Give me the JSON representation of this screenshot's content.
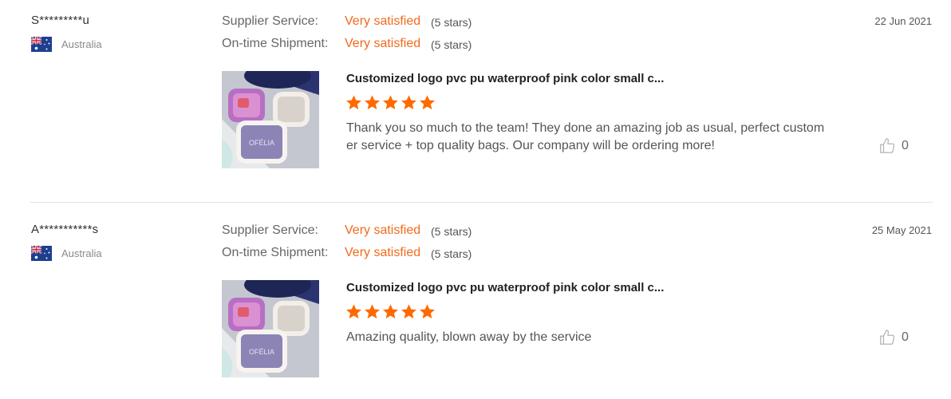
{
  "reviews": [
    {
      "user": "S*********u",
      "country": "Australia",
      "supplier_label": "Supplier Service:",
      "supplier_value": "Very satisfied",
      "supplier_stars": "(5 stars)",
      "shipment_label": "On-time Shipment:",
      "shipment_value": "Very satisfied",
      "shipment_stars": "(5 stars)",
      "date": "22 Jun 2021",
      "product_title": "Customized logo pvc pu waterproof pink color small c...",
      "rating": 5,
      "comment": "Thank you so much to the team! They done an amazing job as usual, perfect customer service + top quality bags. Our company will be ordering more!",
      "likes": "0",
      "flag_icon": "australia-flag-icon"
    },
    {
      "user": "A***********s",
      "country": "Australia",
      "supplier_label": "Supplier Service:",
      "supplier_value": "Very satisfied",
      "supplier_stars": "(5 stars)",
      "shipment_label": "On-time Shipment:",
      "shipment_value": "Very satisfied",
      "shipment_stars": "(5 stars)",
      "date": "25 May 2021",
      "product_title": "Customized logo pvc pu waterproof pink color small c...",
      "rating": 5,
      "comment": "Amazing quality, blown away by the service",
      "likes": "0",
      "flag_icon": "australia-flag-icon"
    }
  ],
  "colors": {
    "accent": "#f26a1b",
    "star": "#ff6a00",
    "divider": "#e4e4e4"
  }
}
